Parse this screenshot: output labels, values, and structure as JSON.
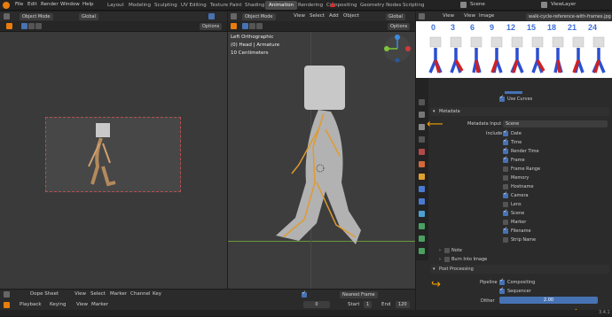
{
  "topbar": {
    "menus": [
      "File",
      "Edit",
      "Render",
      "Window",
      "Help"
    ],
    "tabs": [
      "Layout",
      "Modeling",
      "Sculpting",
      "UV Editing",
      "Texture Paint",
      "Shading",
      "Animation",
      "Rendering",
      "Compositing",
      "Geometry Nodes",
      "Scripting"
    ],
    "active_tab": "Animation",
    "scene": "Scene",
    "view_layer": "ViewLayer"
  },
  "left_header": {
    "mode": "Object Mode",
    "transform": "Global",
    "options": "Options"
  },
  "right_header": {
    "mode": "Object Mode",
    "menus": [
      "View",
      "Select",
      "Add",
      "Object"
    ],
    "transform": "Global",
    "options": "Options"
  },
  "viewport_info": {
    "line1": "Left Orthographic",
    "line2": "(0) Head | Armature",
    "line3": "10 Centimeters"
  },
  "image_editor": {
    "menus": [
      "View",
      "View",
      "Image"
    ],
    "file": "walk-cycle-reference-with-frames.jpg",
    "frames": [
      "0",
      "3",
      "6",
      "9",
      "12",
      "15",
      "18",
      "21",
      "24"
    ]
  },
  "props": {
    "use_curves": "Use Curves",
    "metadata": "Metadata",
    "metadata_input_label": "Metadata Input",
    "metadata_input_value": "Scene",
    "include": "Include",
    "items": [
      {
        "label": "Date",
        "checked": true
      },
      {
        "label": "Time",
        "checked": true
      },
      {
        "label": "Render Time",
        "checked": true
      },
      {
        "label": "Frame",
        "checked": true
      },
      {
        "label": "Frame Range",
        "checked": false
      },
      {
        "label": "Memory",
        "checked": false
      },
      {
        "label": "Hostname",
        "checked": false
      },
      {
        "label": "Camera",
        "checked": true
      },
      {
        "label": "Lens",
        "checked": false
      },
      {
        "label": "Scene",
        "checked": true
      },
      {
        "label": "Marker",
        "checked": false
      },
      {
        "label": "Filename",
        "checked": true
      },
      {
        "label": "Strip Name",
        "checked": false
      }
    ],
    "note": "Note",
    "burn": "Burn Into Image",
    "post_processing": "Post Processing",
    "pipeline": "Pipeline",
    "compositing": "Compositing",
    "sequencer": "Sequencer",
    "dither_label": "Dither",
    "dither_value": "2.00"
  },
  "dopesheet": {
    "editor": "Dope Sheet",
    "menus": [
      "View",
      "Select",
      "Marker",
      "Channel",
      "Key"
    ],
    "snap": "Nearest Frame",
    "playback": "Playback",
    "keying": "Keying",
    "view": "View",
    "marker": "Marker",
    "current_frame": "0",
    "start_label": "Start",
    "start": "1",
    "end_label": "End",
    "end": "120"
  },
  "version": "3.4.1",
  "colors": {
    "accent": "#4772b3",
    "orange": "#e87d0d",
    "frame_digits": "#3d6fd9"
  }
}
